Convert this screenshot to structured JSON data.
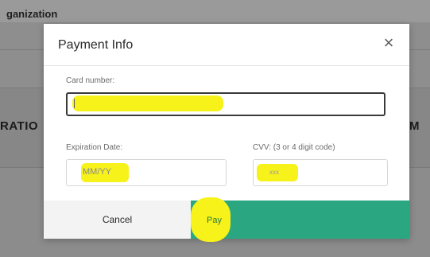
{
  "background": {
    "top_text": "ganization",
    "left_text": "RATIO",
    "right_text": "M"
  },
  "modal": {
    "title": "Payment Info",
    "close_symbol": "×",
    "card_number": {
      "label": "Card number:",
      "value": "",
      "highlight_color": "#f6f21a"
    },
    "expiration": {
      "label": "Expiration Date:",
      "placeholder": "MM/YY"
    },
    "cvv": {
      "label": "CVV: (3 or 4 digit code)",
      "placeholder": "xxx"
    },
    "buttons": {
      "cancel": "Cancel",
      "pay": "Pay",
      "pay_color": "#2aa781"
    }
  },
  "icons": {
    "close": "close-icon"
  }
}
